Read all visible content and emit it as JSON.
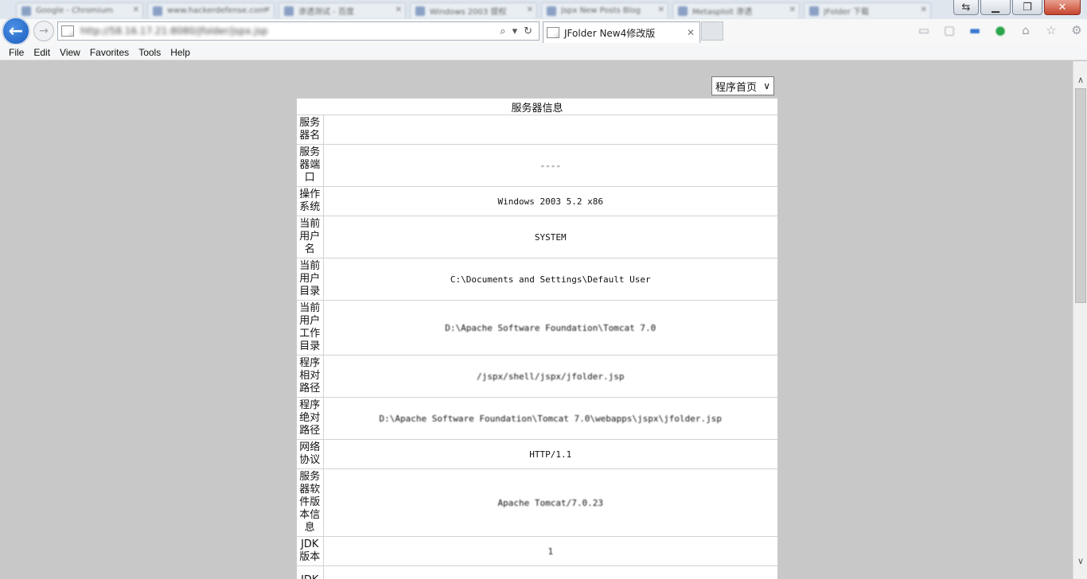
{
  "browser": {
    "background_tabs": [
      {
        "label": "Google - Chromium"
      },
      {
        "label": "www.hackerdefense.com"
      },
      {
        "label": "渗透测试 - 百度"
      },
      {
        "label": "Windows 2003 提权"
      },
      {
        "label": "Jspx New Posts Blog"
      },
      {
        "label": "Metasploit 渗透"
      },
      {
        "label": "JFolder 下载"
      }
    ],
    "window_buttons": {
      "restore": "⇆",
      "minimize": "▁",
      "maximize": "❐",
      "close": "✕"
    },
    "url": "http://58.16.17.21:8080/jfolder/jspx.jsp",
    "address_tools": {
      "search": "⌕",
      "dropdown": "▾",
      "refresh": "↻"
    },
    "active_tab": {
      "title": "JFolder New4修改版",
      "close": "✕"
    },
    "colors": {
      "back_button": "#1d5fbf",
      "content_bg": "#c8c8c8",
      "close_button": "#c6452e"
    }
  },
  "menu": [
    "File",
    "Edit",
    "View",
    "Favorites",
    "Tools",
    "Help"
  ],
  "page": {
    "select": {
      "value": "程序首页",
      "arrow": "∨"
    },
    "table": {
      "heading": "服务器信息",
      "rows": [
        {
          "label": "服务器名",
          "value": ""
        },
        {
          "label": "服务器端口",
          "value": "----"
        },
        {
          "label": "操作系统",
          "value": "Windows 2003 5.2 x86"
        },
        {
          "label": "当前用户名",
          "value": "SYSTEM"
        },
        {
          "label": "当前用户目录",
          "value": "C:\\Documents and Settings\\Default User"
        },
        {
          "label": "当前用户工作目录",
          "value": "D:\\Apache Software Foundation\\Tomcat 7.0"
        },
        {
          "label": "程序相对路径",
          "value": "/jspx/shell/jspx/jfolder.jsp"
        },
        {
          "label": "程序绝对路径",
          "value": "D:\\Apache Software Foundation\\Tomcat 7.0\\webapps\\jspx\\jfolder.jsp"
        },
        {
          "label": "网络协议",
          "value": "HTTP/1.1"
        },
        {
          "label": "服务器软件版本信息",
          "value": "Apache Tomcat/7.0.23"
        },
        {
          "label": "JDK版本",
          "value": "1"
        },
        {
          "label": "JDK",
          "value": ""
        }
      ]
    }
  },
  "scrollbar": {
    "up": "∧",
    "down": "∨"
  }
}
